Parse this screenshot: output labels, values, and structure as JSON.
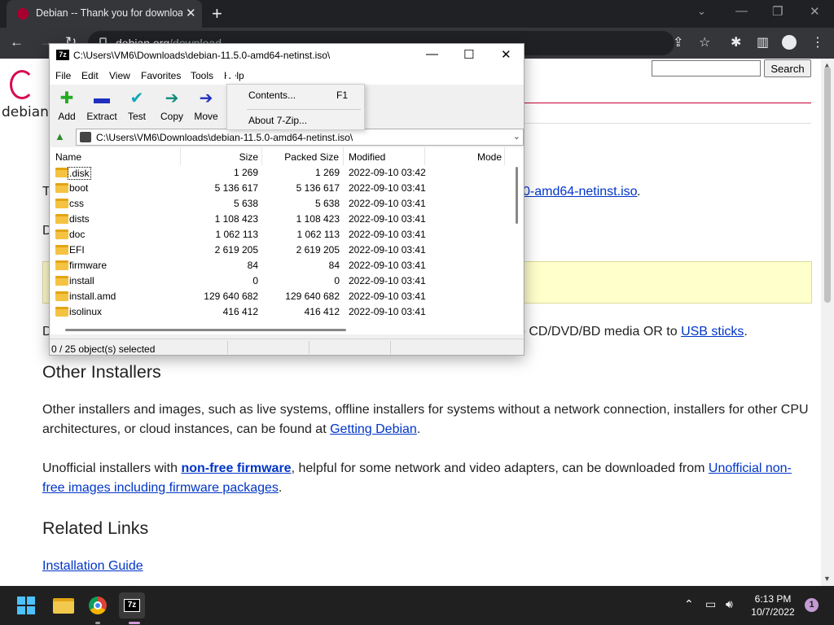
{
  "browser": {
    "tab_title": "Debian -- Thank you for downloading Debian",
    "url_host": "debian.org",
    "url_path": "/download"
  },
  "page": {
    "logo_text": "debian",
    "search_button": "Search",
    "iso_link_fragment": "0-amd64-netinst.iso",
    "iso_link_suffix": ".",
    "usb_prefix": "o CD/DVD/BD media OR to ",
    "usb_link": "USB sticks",
    "usb_suffix": ".",
    "left_fragments": [
      "T",
      "D",
      "D"
    ],
    "other_installers_heading": "Other Installers",
    "other_installers_text": "Other installers and images, such as live systems, offline installers for systems without a network connection, installers for other CPU architectures, or cloud instances, can be found at ",
    "getting_debian_link": "Getting Debian",
    "unofficial_prefix": "Unofficial installers with ",
    "nonfree_link": "non-free firmware",
    "unofficial_middle": ", helpful for some network and video adapters, can be downloaded from ",
    "unofficial_link": "Unofficial non-free images including firmware packages",
    "unofficial_suffix": ".",
    "related_heading": "Related Links",
    "installation_guide_link": "Installation Guide"
  },
  "zip": {
    "title": "C:\\Users\\VM6\\Downloads\\debian-11.5.0-amd64-netinst.iso\\",
    "logo": "7z",
    "menu": [
      "File",
      "Edit",
      "View",
      "Favorites",
      "Tools",
      "Help"
    ],
    "tools": [
      {
        "label": "Add",
        "icon": "plus-icon",
        "color": "#22aa22",
        "glyph": "✚"
      },
      {
        "label": "Extract",
        "icon": "minus-icon",
        "color": "#1f2fbf",
        "glyph": "▬"
      },
      {
        "label": "Test",
        "icon": "check-icon",
        "color": "#11a6b8",
        "glyph": "✔"
      },
      {
        "label": "Copy",
        "icon": "copy-arrow-icon",
        "color": "#138a7a",
        "glyph": "➔"
      },
      {
        "label": "Move",
        "icon": "move-arrow-icon",
        "color": "#1f2fbf",
        "glyph": "➔"
      }
    ],
    "address": "C:\\Users\\VM6\\Downloads\\debian-11.5.0-amd64-netinst.iso\\",
    "columns": [
      "Name",
      "Size",
      "Packed Size",
      "Modified",
      "Mode"
    ],
    "files": [
      {
        "name": ".disk",
        "size": "1 269",
        "packed": "1 269",
        "modified": "2022-09-10 03:42"
      },
      {
        "name": "boot",
        "size": "5 136 617",
        "packed": "5 136 617",
        "modified": "2022-09-10 03:41"
      },
      {
        "name": "css",
        "size": "5 638",
        "packed": "5 638",
        "modified": "2022-09-10 03:41"
      },
      {
        "name": "dists",
        "size": "1 108 423",
        "packed": "1 108 423",
        "modified": "2022-09-10 03:41"
      },
      {
        "name": "doc",
        "size": "1 062 113",
        "packed": "1 062 113",
        "modified": "2022-09-10 03:41"
      },
      {
        "name": "EFI",
        "size": "2 619 205",
        "packed": "2 619 205",
        "modified": "2022-09-10 03:41"
      },
      {
        "name": "firmware",
        "size": "84",
        "packed": "84",
        "modified": "2022-09-10 03:41"
      },
      {
        "name": "install",
        "size": "0",
        "packed": "0",
        "modified": "2022-09-10 03:41"
      },
      {
        "name": "install.amd",
        "size": "129 640 682",
        "packed": "129 640 682",
        "modified": "2022-09-10 03:41"
      },
      {
        "name": "isolinux",
        "size": "416 412",
        "packed": "416 412",
        "modified": "2022-09-10 03:41"
      }
    ],
    "status": "0 / 25 object(s) selected",
    "help_menu": [
      {
        "label": "Contents...",
        "shortcut": "F1"
      },
      {
        "label": "About 7-Zip...",
        "shortcut": ""
      }
    ]
  },
  "taskbar": {
    "time": "6:13 PM",
    "date": "10/7/2022",
    "notifications": "1",
    "zip_label": "7z"
  }
}
